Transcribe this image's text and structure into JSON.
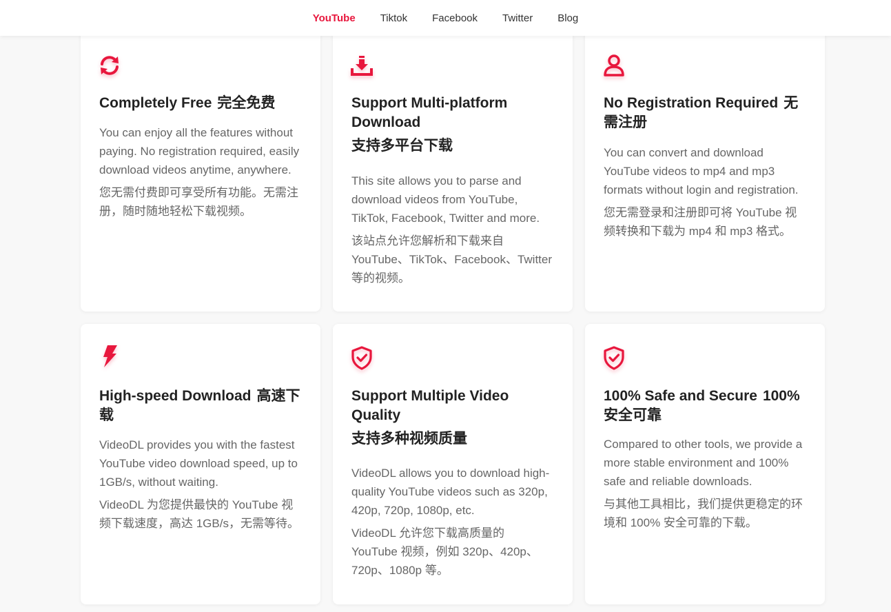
{
  "nav": {
    "items": [
      {
        "label": "YouTube",
        "active": true
      },
      {
        "label": "Tiktok",
        "active": false
      },
      {
        "label": "Facebook",
        "active": false
      },
      {
        "label": "Twitter",
        "active": false
      },
      {
        "label": "Blog",
        "active": false
      }
    ]
  },
  "colors": {
    "accent": "#e8173d"
  },
  "features": [
    {
      "icon": "refresh-icon",
      "title_en": "Completely Free",
      "title_zh": "完全免费",
      "desc_en": "You can enjoy all the features without paying. No registration required, easily download videos anytime, anywhere.",
      "desc_zh": "您无需付费即可享受所有功能。无需注册，随时随地轻松下载视频。"
    },
    {
      "icon": "download-icon",
      "title_en": "Support Multi-platform Download",
      "title_zh": "支持多平台下载",
      "desc_en": "This site allows you to parse and download videos from YouTube, TikTok, Facebook, Twitter and more.",
      "desc_zh": "该站点允许您解析和下载来自 YouTube、TikTok、Facebook、Twitter 等的视频。"
    },
    {
      "icon": "user-icon",
      "title_en": "No Registration Required",
      "title_zh": "无需注册",
      "desc_en": "You can convert and download YouTube videos to mp4 and mp3 formats without login and registration.",
      "desc_zh": "您无需登录和注册即可将 YouTube 视频转换和下载为 mp4 和 mp3 格式。"
    },
    {
      "icon": "lightning-icon",
      "title_en": "High-speed Download",
      "title_zh": "高速下载",
      "desc_en": "VideoDL provides you with the fastest YouTube video download speed, up to 1GB/s, without waiting.",
      "desc_zh": "VideoDL 为您提供最快的 YouTube 视频下载速度，高达 1GB/s，无需等待。"
    },
    {
      "icon": "shield-check-icon",
      "title_en": "Support Multiple Video Quality",
      "title_zh": "支持多种视频质量",
      "desc_en": "VideoDL allows you to download high-quality YouTube videos such as 320p, 420p, 720p, 1080p, etc.",
      "desc_zh": "VideoDL 允许您下载高质量的 YouTube 视频，例如 320p、420p、720p、1080p 等。"
    },
    {
      "icon": "shield-check-icon",
      "title_en": "100% Safe and Secure",
      "title_zh": "100% 安全可靠",
      "desc_en": "Compared to other tools, we provide a more stable environment and 100% safe and reliable downloads.",
      "desc_zh": "与其他工具相比，我们提供更稳定的环境和 100% 安全可靠的下载。"
    }
  ]
}
